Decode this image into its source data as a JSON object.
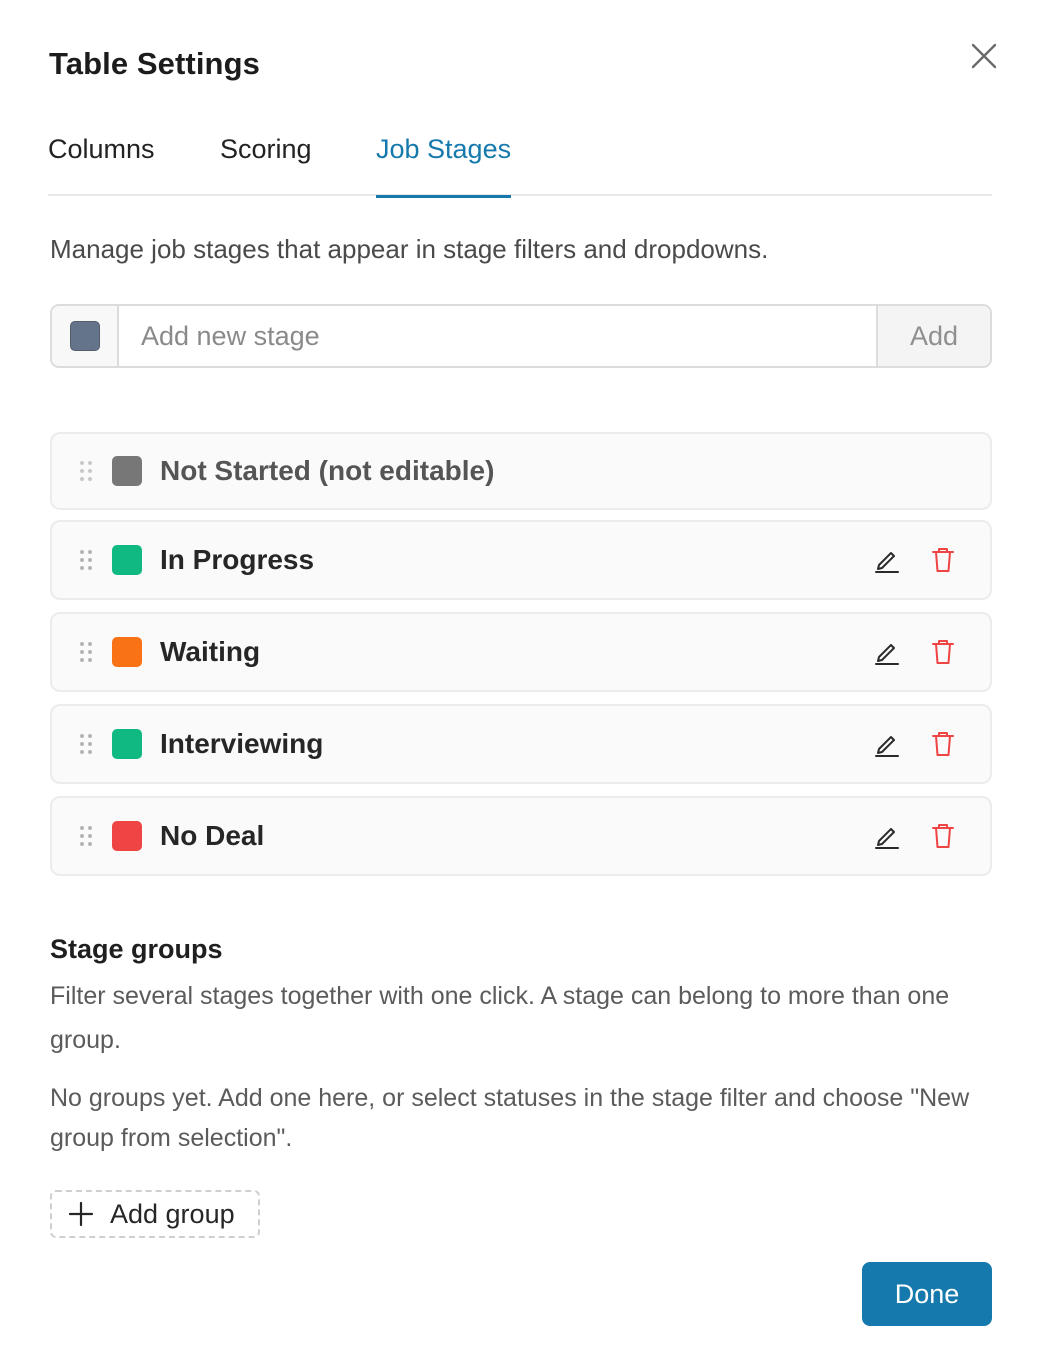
{
  "dialog": {
    "title": "Table Settings"
  },
  "tabs": [
    {
      "label": "Columns",
      "active": false
    },
    {
      "label": "Scoring",
      "active": false
    },
    {
      "label": "Job Stages",
      "active": true
    }
  ],
  "description": "Manage job stages that appear in stage filters and dropdowns.",
  "add_stage": {
    "placeholder": "Add new stage",
    "button_label": "Add",
    "default_color": "#64748b"
  },
  "stages": [
    {
      "name": "Not Started (not editable)",
      "color": "#777777",
      "editable": false
    },
    {
      "name": "In Progress",
      "color": "#10b981",
      "editable": true
    },
    {
      "name": "Waiting",
      "color": "#f97316",
      "editable": true
    },
    {
      "name": "Interviewing",
      "color": "#10b981",
      "editable": true
    },
    {
      "name": "No Deal",
      "color": "#ef4444",
      "editable": true
    }
  ],
  "stage_groups": {
    "title": "Stage groups",
    "description": "Filter several stages together with one click. A stage can belong to more than one group.",
    "empty_message": "No groups yet. Add one here, or select statuses in the stage filter and choose \"New group from selection\".",
    "add_label": "Add group"
  },
  "footer": {
    "done_label": "Done"
  },
  "colors": {
    "accent": "#1679ad",
    "delete": "#ef4444"
  }
}
